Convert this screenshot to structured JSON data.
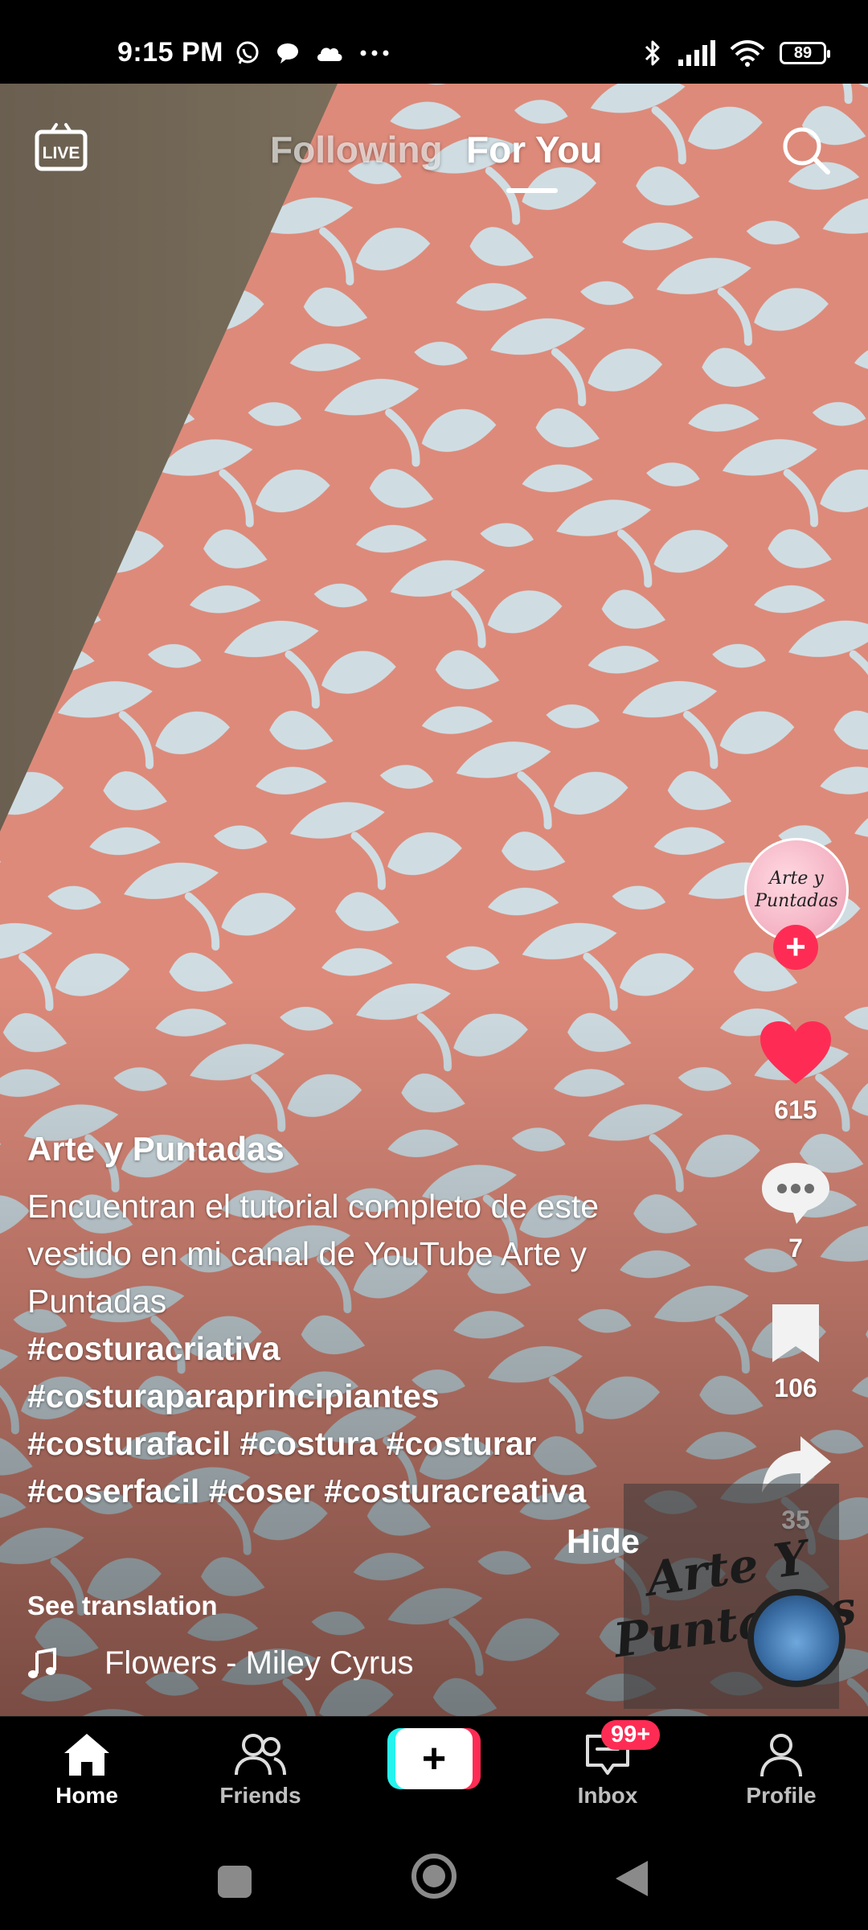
{
  "status_bar": {
    "time": "9:15 PM",
    "left_icons": [
      "whatsapp-icon",
      "chat-bubble-icon",
      "cloud-icon",
      "more-dots-icon"
    ],
    "right_icons": [
      "bluetooth-icon",
      "signal-icon",
      "wifi-icon"
    ],
    "battery": "89"
  },
  "top_nav": {
    "live_label": "LIVE",
    "tabs": [
      {
        "label": "Following",
        "active": false
      },
      {
        "label": "For You",
        "active": true
      }
    ]
  },
  "creator": {
    "avatar_text": "Arte y Puntadas",
    "follow_symbol": "+"
  },
  "actions": {
    "likes": "615",
    "comments": "7",
    "bookmarks": "106",
    "shares": "35"
  },
  "post": {
    "author": "Arte y Puntadas",
    "description": "Encuentran el tutorial completo de este vestido en mi canal de YouTube Arte y Puntadas",
    "hashtags_1": "#costuracriativa",
    "hashtags_2": "#costuraparaprincipiantes",
    "hashtags_3": "#costurafacil #costura #costurar",
    "hashtags_4": "#coserfacil #coser #costuracreativa",
    "hide_label": "Hide",
    "see_translation": "See translation",
    "sound": "Flowers - Miley Cyrus",
    "watermark": "Arte Y Puntadas"
  },
  "bottom_nav": {
    "items": [
      {
        "label": "Home",
        "icon": "home-icon",
        "active": true
      },
      {
        "label": "Friends",
        "icon": "friends-icon",
        "active": false
      },
      {
        "label": "Inbox",
        "icon": "inbox-icon",
        "active": false
      },
      {
        "label": "Profile",
        "icon": "profile-icon",
        "active": false
      }
    ],
    "create_symbol": "+",
    "inbox_badge": "99+"
  },
  "colors": {
    "accent": "#fe2c55",
    "cyan": "#25f4ee",
    "fabric_coral": "#dd8a7a",
    "fabric_leaf": "#cfdde3"
  }
}
